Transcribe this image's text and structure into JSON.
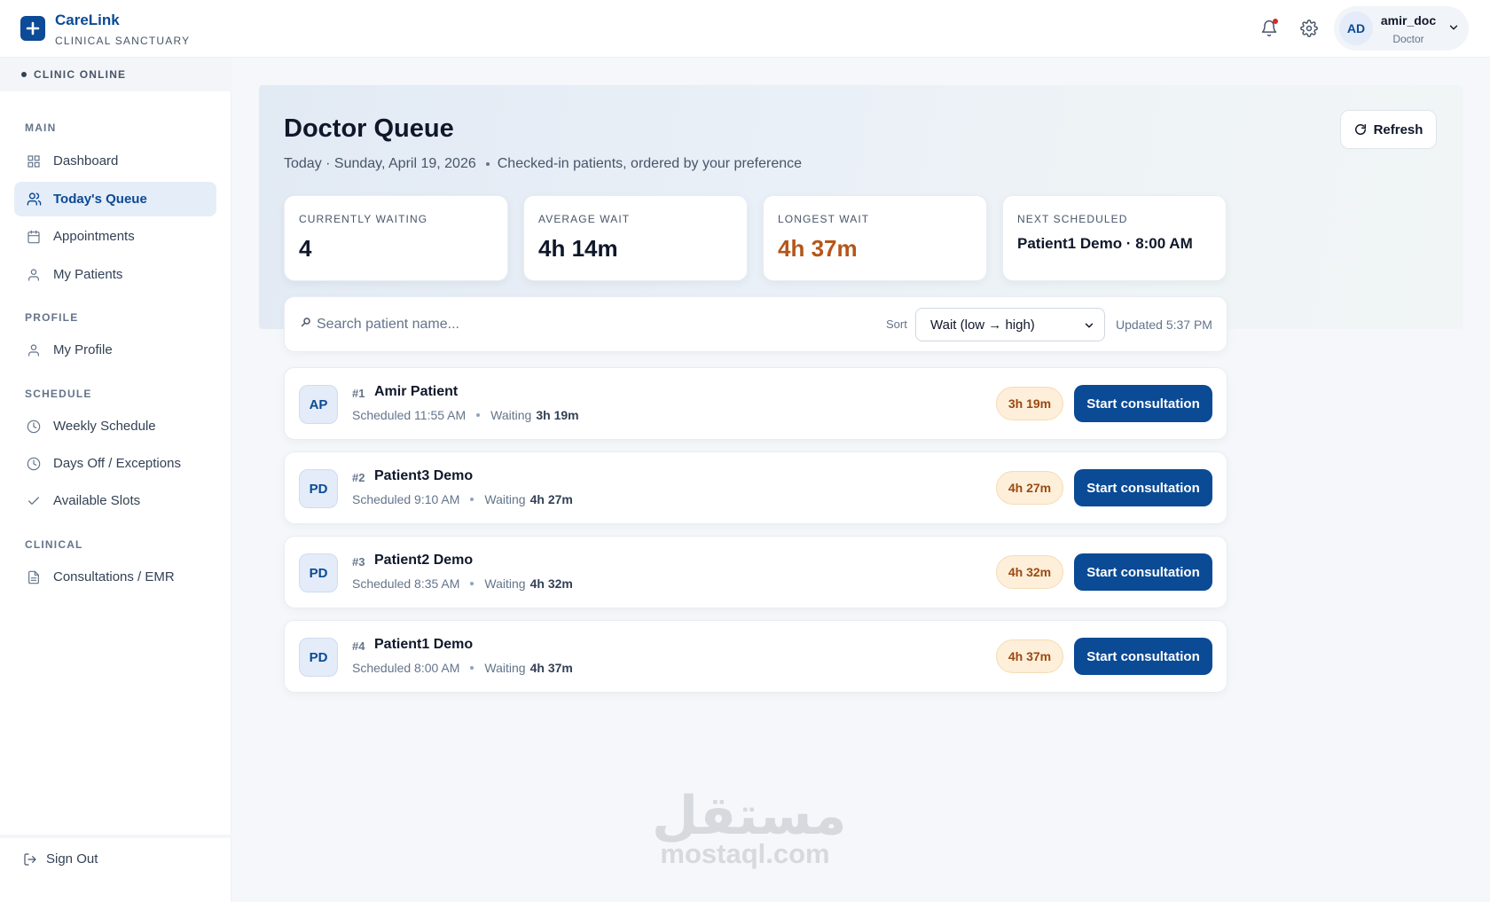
{
  "brand": {
    "name": "CareLink",
    "subtitle": "CLINICAL SANCTUARY"
  },
  "header": {
    "user": {
      "initials": "AD",
      "name": "amir_doc",
      "role": "Doctor"
    },
    "icons": [
      "bell-icon",
      "gear-icon",
      "chevron-down-icon"
    ]
  },
  "sidebar": {
    "status": "CLINIC ONLINE",
    "sections": {
      "main": "MAIN",
      "profile": "PROFILE",
      "schedule": "SCHEDULE",
      "clinical": "CLINICAL"
    },
    "items": {
      "dashboard": "Dashboard",
      "todays_queue": "Today's Queue",
      "appointments": "Appointments",
      "my_patients": "My Patients",
      "my_profile": "My Profile",
      "weekly_schedule": "Weekly Schedule",
      "days_off": "Days Off / Exceptions",
      "available_slots": "Available Slots",
      "consultations": "Consultations / EMR"
    },
    "active": "todays_queue",
    "sign_out": "Sign Out"
  },
  "page": {
    "title": "Doctor Queue",
    "date": "Today · Sunday, April 19, 2026",
    "description": "Checked-in patients, ordered by your preference",
    "refresh_label": "Refresh"
  },
  "stats": {
    "currently_waiting": {
      "label": "CURRENTLY WAITING",
      "value": "4"
    },
    "average_wait": {
      "label": "AVERAGE WAIT",
      "value": "4h 14m"
    },
    "longest_wait": {
      "label": "LONGEST WAIT",
      "value": "4h 37m"
    },
    "next_scheduled": {
      "label": "NEXT SCHEDULED",
      "value": "Patient1 Demo · 8:00 AM"
    }
  },
  "toolbar": {
    "search_placeholder": "Search patient name...",
    "sort_label": "Sort",
    "sort_value": "Wait (low → high)",
    "updated": "Updated 5:37 PM"
  },
  "queue": [
    {
      "initials": "AP",
      "number": "#1",
      "name": "Amir Patient",
      "scheduled": "Scheduled 11:55 AM",
      "waiting_label": "Waiting",
      "waiting": "3h 19m",
      "badge": "3h 19m",
      "action": "Start consultation"
    },
    {
      "initials": "PD",
      "number": "#2",
      "name": "Patient3 Demo",
      "scheduled": "Scheduled 9:10 AM",
      "waiting_label": "Waiting",
      "waiting": "4h 27m",
      "badge": "4h 27m",
      "action": "Start consultation"
    },
    {
      "initials": "PD",
      "number": "#3",
      "name": "Patient2 Demo",
      "scheduled": "Scheduled 8:35 AM",
      "waiting_label": "Waiting",
      "waiting": "4h 32m",
      "badge": "4h 32m",
      "action": "Start consultation"
    },
    {
      "initials": "PD",
      "number": "#4",
      "name": "Patient1 Demo",
      "scheduled": "Scheduled 8:00 AM",
      "waiting_label": "Waiting",
      "waiting": "4h 37m",
      "badge": "4h 37m",
      "action": "Start consultation"
    }
  ],
  "watermark": {
    "arabic": "مستقل",
    "latin": "mostaql.com"
  },
  "colors": {
    "primary": "#0b4a95",
    "warning": "#b4561a",
    "badge_bg": "#fdefd9"
  }
}
